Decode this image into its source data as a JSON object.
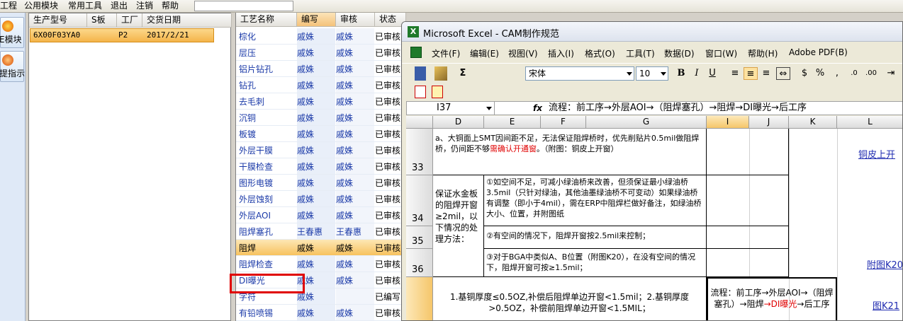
{
  "app_menu": {
    "items": [
      "工程",
      "公用模块",
      "常用工具",
      "退出",
      "注销",
      "帮助"
    ]
  },
  "left_toolbar": {
    "buttons": [
      "E模块",
      "提指示"
    ]
  },
  "product_panel": {
    "headers": [
      "生产型号",
      "S板",
      "工厂",
      "交货日期"
    ],
    "row": {
      "model": "6X00F03YA0",
      "plant": "P2",
      "date": "2017/2/21"
    }
  },
  "process_panel": {
    "headers": [
      "工艺名称",
      "编写",
      "审核",
      "状态"
    ],
    "rows": [
      {
        "name": "棕化",
        "editor": "戚姝",
        "reviewer": "戚姝",
        "status": "已审核"
      },
      {
        "name": "层压",
        "editor": "戚姝",
        "reviewer": "戚姝",
        "status": "已审核"
      },
      {
        "name": "铝片钻孔",
        "editor": "戚姝",
        "reviewer": "戚姝",
        "status": "已审核"
      },
      {
        "name": "钻孔",
        "editor": "戚姝",
        "reviewer": "戚姝",
        "status": "已审核"
      },
      {
        "name": "去毛刺",
        "editor": "戚姝",
        "reviewer": "戚姝",
        "status": "已审核"
      },
      {
        "name": "沉铜",
        "editor": "戚姝",
        "reviewer": "戚姝",
        "status": "已审核"
      },
      {
        "name": "板镀",
        "editor": "戚姝",
        "reviewer": "戚姝",
        "status": "已审核"
      },
      {
        "name": "外层干膜",
        "editor": "戚姝",
        "reviewer": "戚姝",
        "status": "已审核"
      },
      {
        "name": "干膜检查",
        "editor": "戚姝",
        "reviewer": "戚姝",
        "status": "已审核"
      },
      {
        "name": "图形电镀",
        "editor": "戚姝",
        "reviewer": "戚姝",
        "status": "已审核"
      },
      {
        "name": "外层蚀刻",
        "editor": "戚姝",
        "reviewer": "戚姝",
        "status": "已审核"
      },
      {
        "name": "外层AOI",
        "editor": "戚姝",
        "reviewer": "戚姝",
        "status": "已审核"
      },
      {
        "name": "阻焊塞孔",
        "editor": "王春惠",
        "reviewer": "王春惠",
        "status": "已审核"
      },
      {
        "name": "阻焊",
        "editor": "戚姝",
        "reviewer": "戚姝",
        "status": "已审核"
      },
      {
        "name": "阻焊检查",
        "editor": "戚姝",
        "reviewer": "戚姝",
        "status": "已审核"
      },
      {
        "name": "DI曝光",
        "editor": "戚姝",
        "reviewer": "戚姝",
        "status": "已审核"
      },
      {
        "name": "字符",
        "editor": "戚姝",
        "reviewer": "",
        "status": "已编写"
      },
      {
        "name": "有铅喷锡",
        "editor": "戚姝",
        "reviewer": "戚姝",
        "status": "已审核"
      }
    ]
  },
  "excel": {
    "title": "Microsoft Excel - CAM制作规范",
    "menu": [
      "文件(F)",
      "编辑(E)",
      "视图(V)",
      "插入(I)",
      "格式(O)",
      "工具(T)",
      "数据(D)",
      "窗口(W)",
      "帮助(H)",
      "Adobe PDF(B)"
    ],
    "font_name": "宋体",
    "font_size": "10",
    "name_box": "I37",
    "fx_label": "fx",
    "formula": "流程：前工序→外层AOI→（阻焊塞孔）→阻焊→DI曝光→后工序",
    "columns": [
      "D",
      "E",
      "F",
      "G",
      "I",
      "J",
      "K",
      "L"
    ],
    "rows": [
      "33",
      "34",
      "35",
      "36"
    ],
    "cells": {
      "r33_text_a": "a、大铜面上SMT因间距不足，无法保证阻焊桥时，优先削贴片0.5mil做阻焊桥，仍间距不够",
      "r33_text_red": "需确认开通窗",
      "r33_text_b": "。（附图：铜皮上开窗）",
      "r33_link": "铜皮上开",
      "merged_label": "保证水金板的阻焊开窗≥2mil，以下情况的处理方法：",
      "r34_text": "①如空间不足，可减小绿油桥来改善，但须保证最小绿油桥3.5mil（只针对绿油，其他油墨绿油桥不可变动）如果绿油桥有调整（即小于4mil），需在ERP中阻焊栏做好备注，如绿油桥大小、位置，并附图纸",
      "r35_text": "②有空间的情况下，阻焊开窗按2.5mil来控制；",
      "r36_text": "③对于BGA中类似A、B位置（附图K20），在没有空间的情况下，阻焊开窗可按≥1.5mil；",
      "r36_link": "附图K20",
      "r37_text": "1.基铜厚度≤0.5OZ,补偿后阻焊单边开窗<1.5mil；2.基铜厚度>0.5OZ，补偿前阻焊单边开窗<1.5MIL；",
      "r37_flow_a": "流程：前工序→外层AOI→（阻焊塞孔）→阻焊",
      "r37_flow_red": "→DI曝光",
      "r37_flow_b": "→后工序",
      "r37_link": "图K21"
    }
  }
}
